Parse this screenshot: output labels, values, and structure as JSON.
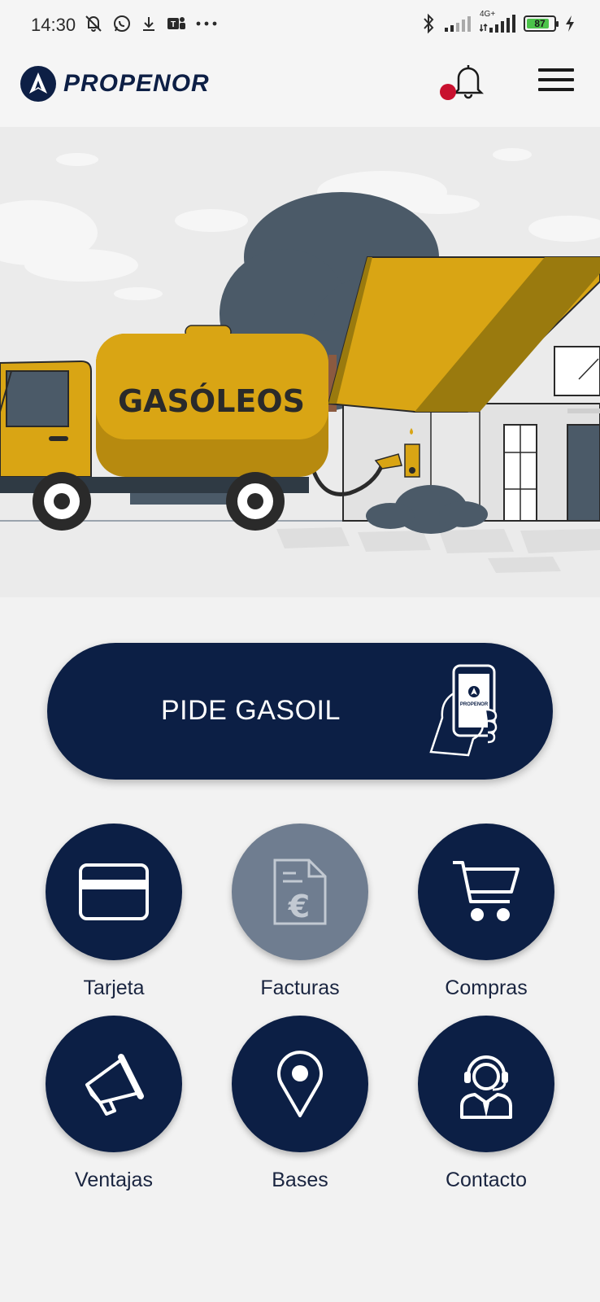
{
  "status_bar": {
    "time": "14:30",
    "battery_level": "87",
    "battery_fraction": 0.87,
    "network": "4G+"
  },
  "app": {
    "brand": "PROPENOR"
  },
  "hero": {
    "truck_text": "GASÓLEOS"
  },
  "cta": {
    "label": "PIDE GASOIL",
    "phone_brand": "PROPENOR"
  },
  "menu_items": [
    {
      "label": "Tarjeta",
      "icon": "credit-card-icon"
    },
    {
      "label": "Facturas",
      "icon": "invoice-euro-icon"
    },
    {
      "label": "Compras",
      "icon": "shopping-cart-icon"
    },
    {
      "label": "Ventajas",
      "icon": "megaphone-icon"
    },
    {
      "label": "Bases",
      "icon": "map-pin-icon"
    },
    {
      "label": "Contacto",
      "icon": "support-agent-icon"
    }
  ],
  "colors": {
    "navy": "#0c1f45",
    "disabled": "#6f7d90",
    "mustard": "#d9a514",
    "notification_dot": "#c8102e"
  }
}
